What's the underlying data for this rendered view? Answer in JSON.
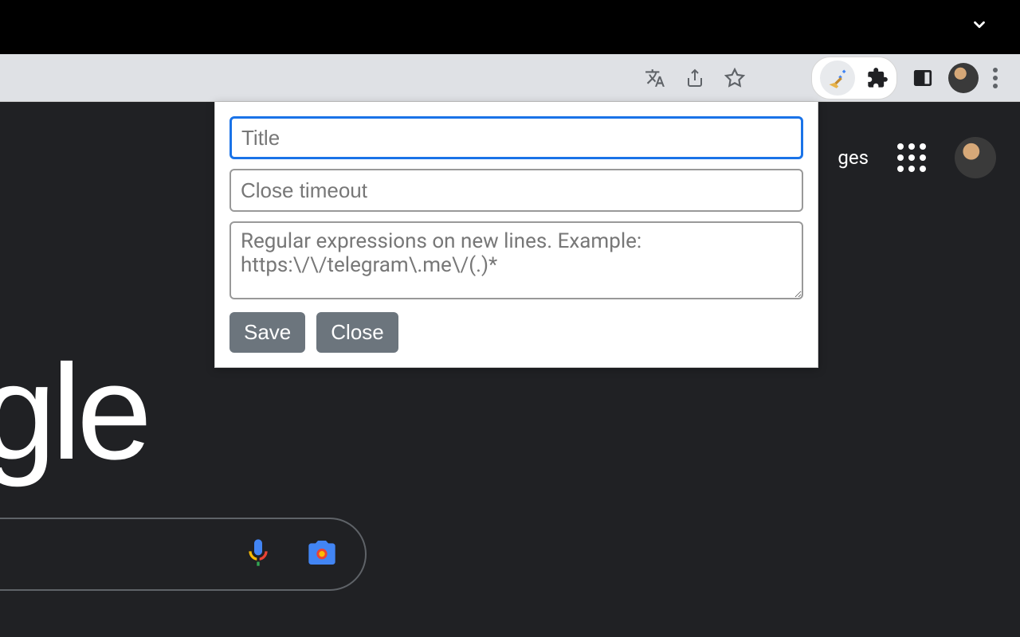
{
  "top_bar": {},
  "browser_toolbar": {
    "icons": {
      "translate": "translate-icon",
      "share": "share-icon",
      "bookmark": "bookmark-star-icon",
      "extension_active": "broom-sparkle-icon",
      "extensions_puzzle": "extensions-puzzle-icon",
      "side_panel": "side-panel-icon",
      "profile_avatar": "profile-avatar",
      "menu": "kebab-menu"
    }
  },
  "extension_popup": {
    "title_input": {
      "placeholder": "Title",
      "value": ""
    },
    "timeout_input": {
      "placeholder": "Close timeout",
      "value": ""
    },
    "regex_textarea": {
      "placeholder": "Regular expressions on new lines. Example: https:\\/\\/telegram\\.me\\/(.)*",
      "value": ""
    },
    "buttons": {
      "save": "Save",
      "close": "Close"
    }
  },
  "google_page": {
    "nav_partial_text": "ges",
    "logo_partial": "gle"
  }
}
